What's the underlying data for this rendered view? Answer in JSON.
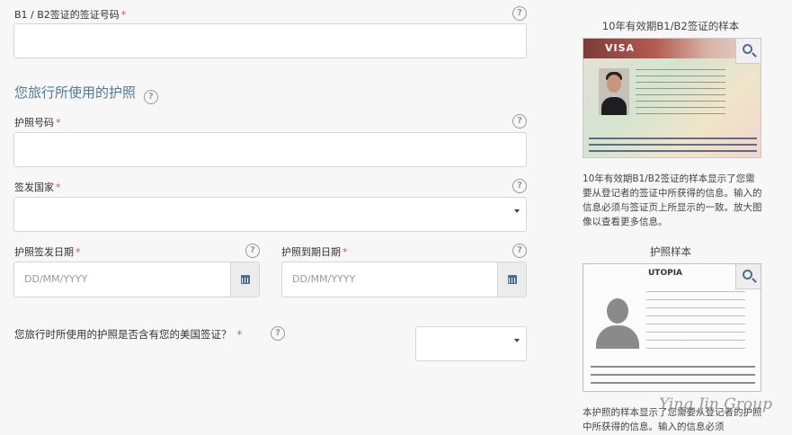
{
  "form": {
    "visa_number_label": "B1 / B2签证的签证号码",
    "section_title": "您旅行所使用的护照",
    "passport_number_label": "护照号码",
    "issuing_country_label": "签发国家",
    "issue_date_label": "护照签发日期",
    "issue_date_placeholder": "DD/MM/YYYY",
    "expiry_date_label": "护照到期日期",
    "expiry_date_placeholder": "DD/MM/YYYY",
    "contains_visa_question": "您旅行时所使用的护照是否含有您的美国签证？",
    "required_mark": "*",
    "help_mark": "?"
  },
  "sidebar": {
    "visa_sample_title": "10年有效期B1/B2签证的样本",
    "visa_sample_desc": "10年有效期B1/B2签证的样本显示了您需要从登记者的签证中所获得的信息。输入的信息必须与签证页上所显示的一致。放大图像以查看更多信息。",
    "visa_image_word": "VISA",
    "passport_sample_title": "护照样本",
    "passport_image_country": "UTOPIA",
    "passport_sample_desc": "本护照的样本显示了您需要从登记者的护照中所获得的信息。输入的信息必须"
  },
  "watermark": "Ying Jin Group"
}
